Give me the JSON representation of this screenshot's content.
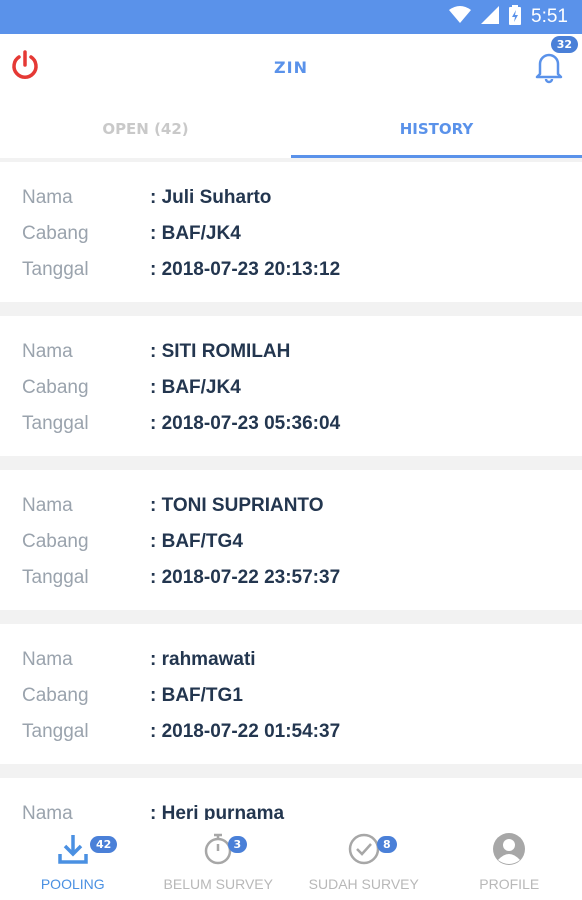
{
  "status_bar": {
    "time": "5:51"
  },
  "header": {
    "title": "ZIN",
    "notification_count": "32"
  },
  "tabs": [
    {
      "label": "OPEN (42)",
      "active": false
    },
    {
      "label": "HISTORY",
      "active": true
    }
  ],
  "labels": {
    "nama": "Nama",
    "cabang": "Cabang",
    "tanggal": "Tanggal"
  },
  "records": [
    {
      "nama": ": Juli Suharto",
      "cabang": ": BAF/JK4",
      "tanggal": ": 2018-07-23 20:13:12"
    },
    {
      "nama": ": SITI ROMILAH",
      "cabang": ": BAF/JK4",
      "tanggal": ": 2018-07-23 05:36:04"
    },
    {
      "nama": ": TONI SUPRIANTO",
      "cabang": ": BAF/TG4",
      "tanggal": ": 2018-07-22 23:57:37"
    },
    {
      "nama": ": rahmawati",
      "cabang": ": BAF/TG1",
      "tanggal": ": 2018-07-22 01:54:37"
    },
    {
      "nama": ": Heri purnama",
      "cabang": "",
      "tanggal": ""
    }
  ],
  "bottom_nav": [
    {
      "label": "POOLING",
      "badge": "42",
      "icon": "download-icon",
      "active": true
    },
    {
      "label": "BELUM SURVEY",
      "badge": "3",
      "icon": "stopwatch-icon",
      "active": false
    },
    {
      "label": "SUDAH SURVEY",
      "badge": "8",
      "icon": "check-circle-icon",
      "active": false
    },
    {
      "label": "PROFILE",
      "badge": "",
      "icon": "profile-icon",
      "active": false
    }
  ],
  "colors": {
    "accent": "#5a92ea",
    "power": "#e53935",
    "badge": "#4a80d8"
  }
}
